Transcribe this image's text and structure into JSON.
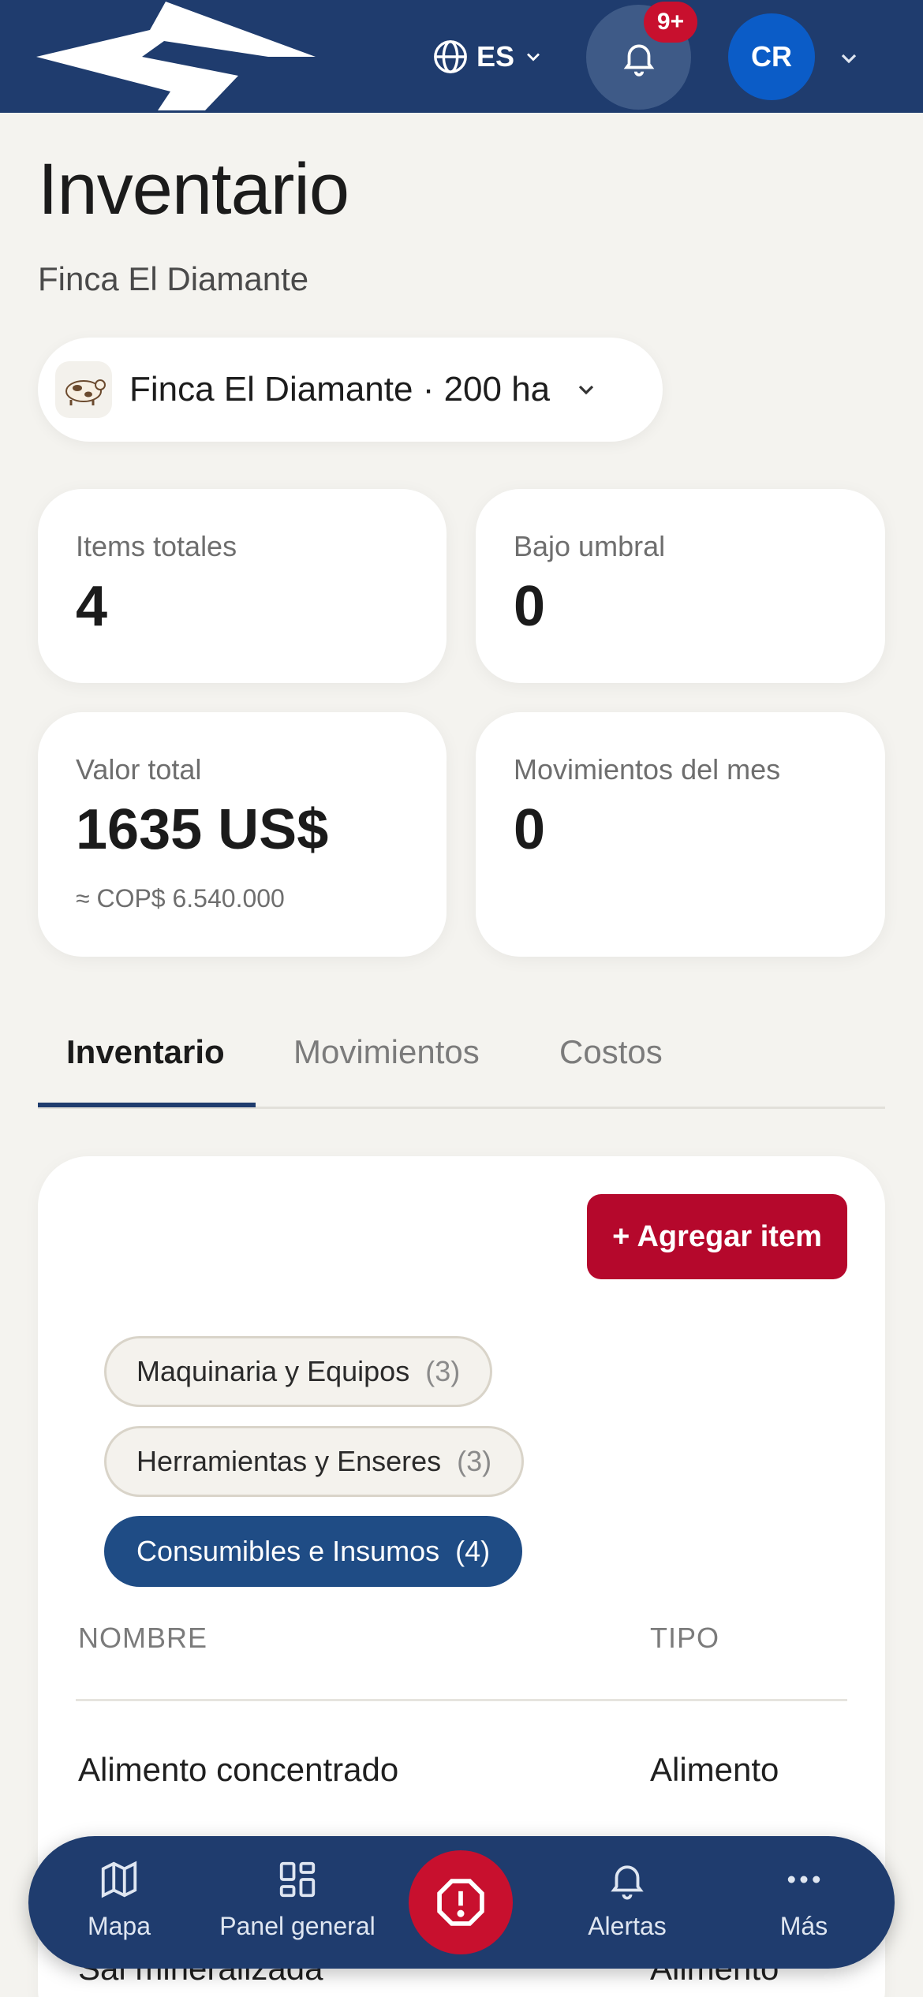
{
  "header": {
    "language": "ES",
    "notification_badge": "9+",
    "avatar_initials": "CR"
  },
  "page": {
    "title": "Inventario",
    "subtitle": "Finca El Diamante",
    "farm_selector": {
      "emoji": "🐄",
      "label": "Finca El Diamante · 200 ha"
    }
  },
  "stats": [
    {
      "label": "Items totales",
      "value": "4",
      "sub": ""
    },
    {
      "label": "Bajo umbral",
      "value": "0",
      "sub": ""
    },
    {
      "label": "Valor total",
      "value": "1635 US$",
      "sub": "≈ COP$ 6.540.000"
    },
    {
      "label": "Movimientos del mes",
      "value": "0",
      "sub": ""
    }
  ],
  "tabs": [
    {
      "label": "Inventario",
      "active": true
    },
    {
      "label": "Movimientos",
      "active": false
    },
    {
      "label": "Costos",
      "active": false
    }
  ],
  "inventory": {
    "add_button": "+ Agregar item",
    "categories": [
      {
        "label": "Maquinaria y Equipos",
        "count": "(3)",
        "active": false
      },
      {
        "label": "Herramientas y Enseres",
        "count": "(3)",
        "active": false
      },
      {
        "label": "Consumibles e Insumos",
        "count": "(4)",
        "active": true
      }
    ],
    "columns": [
      "NOMBRE",
      "TIPO"
    ],
    "rows": [
      {
        "nombre": "Alimento concentrado",
        "tipo": "Alimento"
      },
      {
        "nombre": "Sal mineralizada",
        "tipo": "Alimento"
      }
    ]
  },
  "bottom_nav": [
    {
      "label": "Mapa",
      "icon": "map-icon"
    },
    {
      "label": "Panel general",
      "icon": "dashboard-icon"
    },
    {
      "label": "",
      "icon": "alert-circle-icon"
    },
    {
      "label": "Alertas",
      "icon": "bell-icon"
    },
    {
      "label": "Más",
      "icon": "more-icon"
    }
  ],
  "colors": {
    "header_bg": "#1f3c6e",
    "accent_red": "#b5082c",
    "chip_active": "#1f4c85",
    "page_bg": "#f4f3ef"
  }
}
